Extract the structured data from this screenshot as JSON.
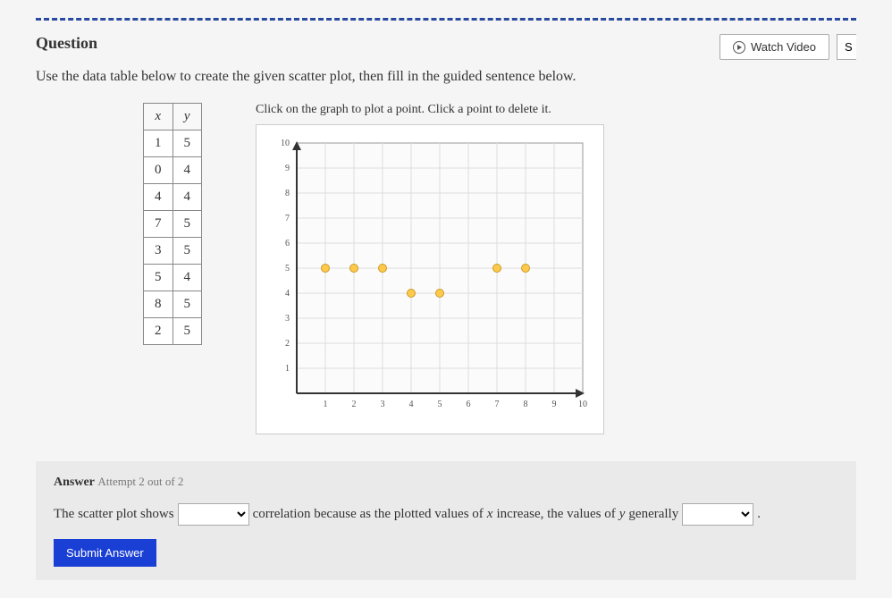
{
  "header": {
    "question_label": "Question",
    "watch_video": "Watch Video",
    "partial": "S"
  },
  "instructions": "Use the data table below to create the given scatter plot, then fill in the guided sentence below.",
  "table": {
    "headers": [
      "x",
      "y"
    ],
    "rows": [
      [
        "1",
        "5"
      ],
      [
        "0",
        "4"
      ],
      [
        "4",
        "4"
      ],
      [
        "7",
        "5"
      ],
      [
        "3",
        "5"
      ],
      [
        "5",
        "4"
      ],
      [
        "8",
        "5"
      ],
      [
        "2",
        "5"
      ]
    ]
  },
  "graph": {
    "instruction": "Click on the graph to plot a point. Click a point to delete it."
  },
  "chart_data": {
    "type": "scatter",
    "xlabel": "",
    "ylabel": "",
    "xlim": [
      0,
      10
    ],
    "ylim": [
      0,
      10
    ],
    "xticks": [
      1,
      2,
      3,
      4,
      5,
      6,
      7,
      8,
      9,
      10
    ],
    "yticks": [
      1,
      2,
      3,
      4,
      5,
      6,
      7,
      8,
      9,
      10
    ],
    "points": [
      {
        "x": 1,
        "y": 5
      },
      {
        "x": 2,
        "y": 5
      },
      {
        "x": 3,
        "y": 5
      },
      {
        "x": 4,
        "y": 4
      },
      {
        "x": 5,
        "y": 4
      },
      {
        "x": 7,
        "y": 5
      },
      {
        "x": 8,
        "y": 5
      }
    ]
  },
  "answer": {
    "label_bold": "Answer",
    "label_light": "Attempt 2 out of 2",
    "sentence_part1": "The scatter plot shows",
    "sentence_part2": "correlation because as the plotted values of",
    "var1": "x",
    "sentence_part3": "increase, the values of",
    "var2": "y",
    "sentence_part4": "generally",
    "period": ".",
    "submit": "Submit Answer"
  }
}
